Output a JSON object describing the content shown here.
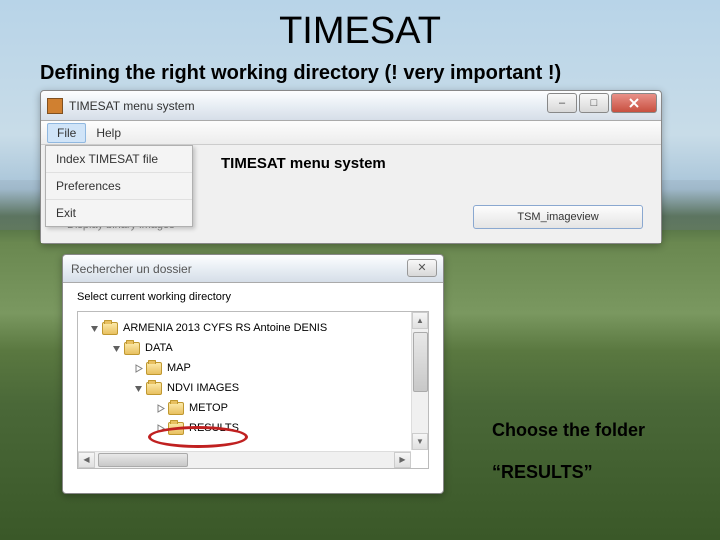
{
  "slide": {
    "title": "TIMESAT",
    "subtitle": "Defining the right working directory (! very important !)",
    "annotation_line1": "Choose the folder",
    "annotation_line2": "“RESULTS”"
  },
  "window1": {
    "title": "TIMESAT menu system",
    "heading": "TIMESAT menu system",
    "menubar": {
      "file": "File",
      "help": "Help"
    },
    "file_menu": {
      "index": "Index TIMESAT file",
      "preferences": "Preferences",
      "exit": "Exit"
    },
    "bg_item": "Display binary images",
    "button": "TSM_imageview",
    "win_controls": {
      "min": "–",
      "max": "□"
    }
  },
  "window2": {
    "title": "Rechercher un dossier",
    "label": "Select current working directory",
    "close": "✕",
    "tree": [
      {
        "level": 0,
        "expanded": true,
        "label": "ARMENIA 2013 CYFS RS Antoine DENIS"
      },
      {
        "level": 1,
        "expanded": true,
        "label": "DATA"
      },
      {
        "level": 2,
        "expanded": false,
        "label": "MAP"
      },
      {
        "level": 2,
        "expanded": true,
        "label": "NDVI IMAGES"
      },
      {
        "level": 3,
        "expanded": false,
        "label": "METOP"
      },
      {
        "level": 3,
        "expanded": false,
        "label": "RESULTS"
      }
    ],
    "scroll": {
      "up": "▲",
      "down": "▼",
      "left": "◀",
      "right": "▶"
    }
  }
}
